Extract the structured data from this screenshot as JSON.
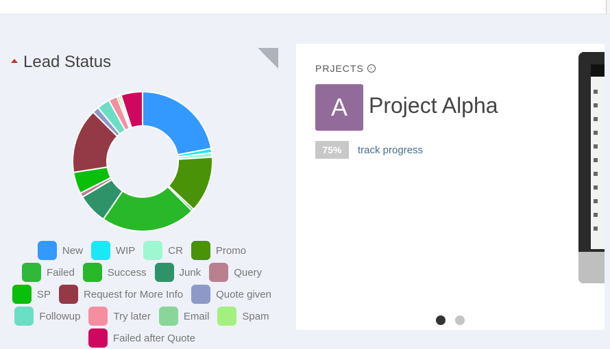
{
  "lead_status": {
    "title": "Lead Status",
    "segments": [
      {
        "label": "New",
        "value": 22,
        "color": "#3399ff"
      },
      {
        "label": "WIP",
        "value": 1,
        "color": "#1ae8f5"
      },
      {
        "label": "CR",
        "value": 1,
        "color": "#9df7d0"
      },
      {
        "label": "Promo",
        "value": 13,
        "color": "#4a9208"
      },
      {
        "label": "Failed",
        "value": 0.5,
        "color": "#2fb83a"
      },
      {
        "label": "Success",
        "value": 22,
        "color": "#29b829"
      },
      {
        "label": "Junk",
        "value": 7,
        "color": "#2f936a"
      },
      {
        "label": "Query",
        "value": 1,
        "color": "#b98090"
      },
      {
        "label": "SP",
        "value": 5,
        "color": "#09bf09"
      },
      {
        "label": "Request for More Info",
        "value": 15,
        "color": "#943a46"
      },
      {
        "label": "Quote given",
        "value": 1.5,
        "color": "#8f99c8"
      },
      {
        "label": "Followup",
        "value": 3,
        "color": "#6bdec6"
      },
      {
        "label": "Try later",
        "value": 2,
        "color": "#f58fa0"
      },
      {
        "label": "Email",
        "value": 0.5,
        "color": "#8ad69a"
      },
      {
        "label": "Spam",
        "value": 0.5,
        "color": "#a3f080"
      },
      {
        "label": "Failed after Quote",
        "value": 5,
        "color": "#d0075f"
      }
    ]
  },
  "project": {
    "section_label": "PRJECTS",
    "avatar_letter": "A",
    "avatar_color": "#936b9b",
    "name": "Project Alpha",
    "progress": "75%",
    "track_label": "track progress"
  },
  "carousel": {
    "active_index": 0,
    "count": 2
  }
}
